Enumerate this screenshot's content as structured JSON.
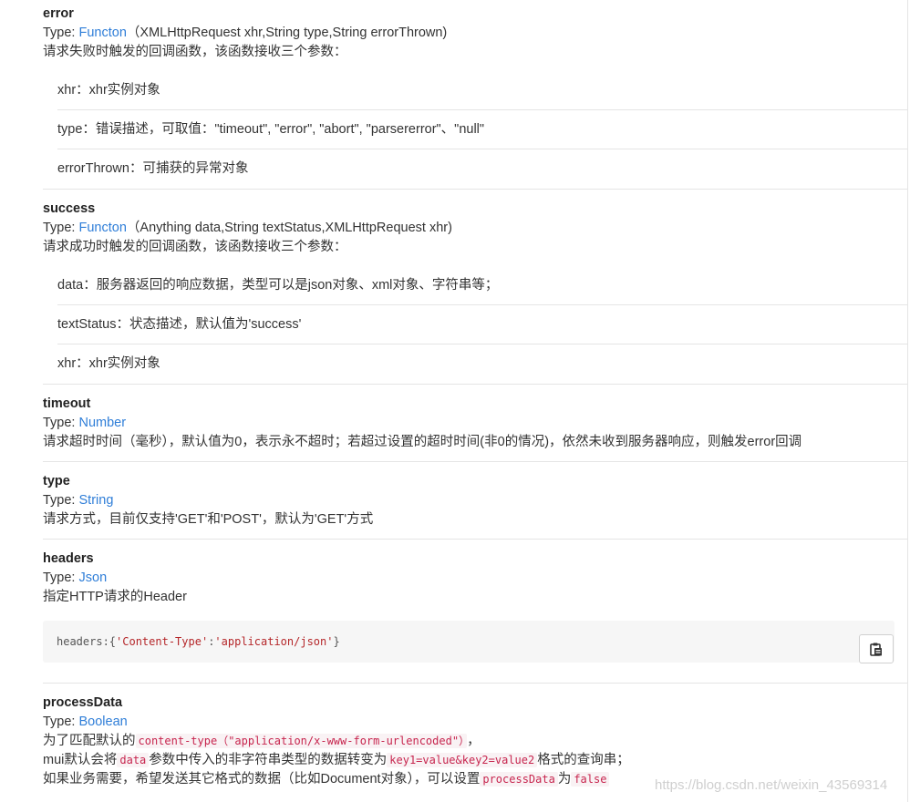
{
  "labels": {
    "type_prefix": "Type: "
  },
  "error": {
    "title": "error",
    "type": "Functon",
    "signature": "（XMLHttpRequest xhr,String type,String errorThrown)",
    "desc": "请求失败时触发的回调函数，该函数接收三个参数：",
    "items": [
      "xhr：xhr实例对象",
      "type：错误描述，可取值：\"timeout\", \"error\", \"abort\", \"parsererror\"、\"null\"",
      "errorThrown：可捕获的异常对象"
    ]
  },
  "success": {
    "title": "success",
    "type": "Functon",
    "signature": "（Anything data,String textStatus,XMLHttpRequest xhr)",
    "desc": "请求成功时触发的回调函数，该函数接收三个参数：",
    "items": [
      "data：服务器返回的响应数据，类型可以是json对象、xml对象、字符串等；",
      "textStatus：状态描述，默认值为'success'",
      "xhr：xhr实例对象"
    ]
  },
  "timeout": {
    "title": "timeout",
    "type": "Number",
    "desc": "请求超时时间（毫秒），默认值为0，表示永不超时；若超过设置的超时时间(非0的情况)，依然未收到服务器响应，则触发error回调"
  },
  "type_param": {
    "title": "type",
    "type": "String",
    "desc": "请求方式，目前仅支持'GET'和'POST'，默认为'GET'方式"
  },
  "headers": {
    "title": "headers",
    "type": "Json",
    "desc": "指定HTTP请求的Header",
    "code": {
      "key": "headers:{",
      "str1": "'Content-Type'",
      "colon": ":",
      "str2": "'application/json'",
      "end": "}"
    },
    "copy_icon": "clipboard-icon"
  },
  "processData": {
    "title": "processData",
    "type": "Boolean",
    "line1_before": "为了匹配默认的",
    "line1_code": "content-type（\"application/x-www-form-urlencoded\"）",
    "line1_after": "，",
    "line2_before": "mui默认会将",
    "line2_code1": "data",
    "line2_mid": "参数中传入的非字符串类型的数据转变为",
    "line2_code2": "key1=value&key2=value2",
    "line2_after": "格式的查询串；",
    "line3_before": "如果业务需要，希望发送其它格式的数据（比如Document对象），可以设置",
    "line3_code1": "processData",
    "line3_mid": "为",
    "line3_code2": "false"
  },
  "watermark": "https://blog.csdn.net/weixin_43569314"
}
